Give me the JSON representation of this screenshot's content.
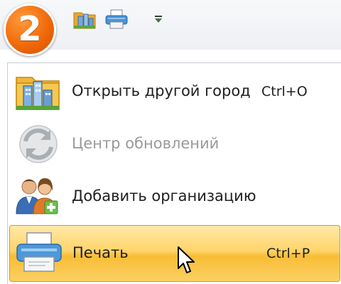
{
  "app_button": {
    "number": "2",
    "color": "#f06a0a"
  },
  "quick_access": {
    "icons": [
      "city-folder-icon",
      "printer-icon",
      "customize-dropdown-icon"
    ]
  },
  "menu": {
    "items": [
      {
        "label": "Открыть другой город",
        "shortcut": "Ctrl+O",
        "icon": "open-city-icon",
        "enabled": true,
        "highlighted": false
      },
      {
        "label": "Центр обновлений",
        "shortcut": "",
        "icon": "update-center-icon",
        "enabled": false,
        "highlighted": false
      },
      {
        "label": "Добавить организацию",
        "shortcut": "",
        "icon": "add-organization-icon",
        "enabled": true,
        "highlighted": false
      },
      {
        "label": "Печать",
        "shortcut": "Ctrl+P",
        "icon": "printer-icon",
        "enabled": true,
        "highlighted": true
      }
    ]
  },
  "colors": {
    "highlight": "#ffd46a",
    "highlight_border": "#d99a10",
    "disabled_text": "#9a9a9a"
  }
}
